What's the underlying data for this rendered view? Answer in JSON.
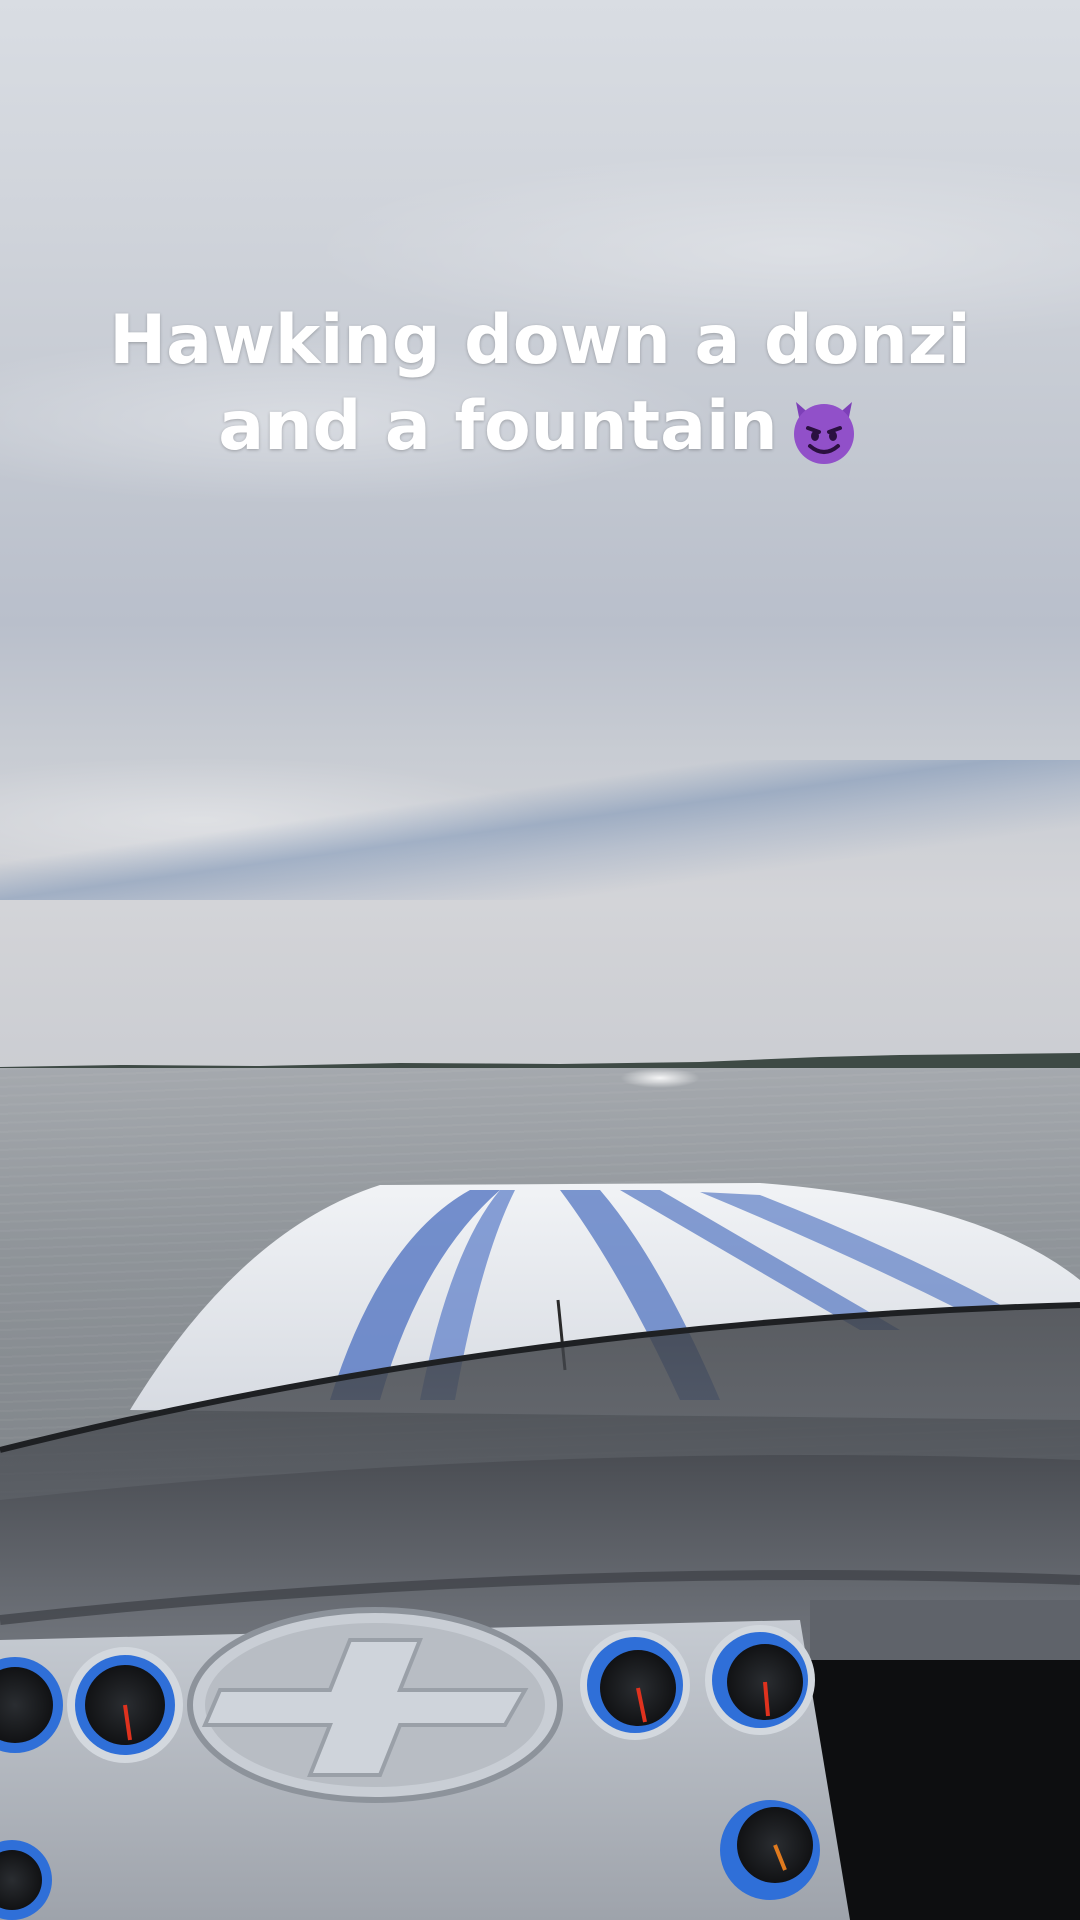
{
  "caption": {
    "line1": "Hawking down a donzi",
    "line2": "and a fountain",
    "emoji": "smiling-devil-emoji"
  },
  "colors": {
    "sky": "#cfd3da",
    "water": "#8f9499",
    "deck_white": "#e8ebf0",
    "stripe_blue": "#5d7dc4",
    "gauge_bezel_blue": "#2f6fd8"
  }
}
